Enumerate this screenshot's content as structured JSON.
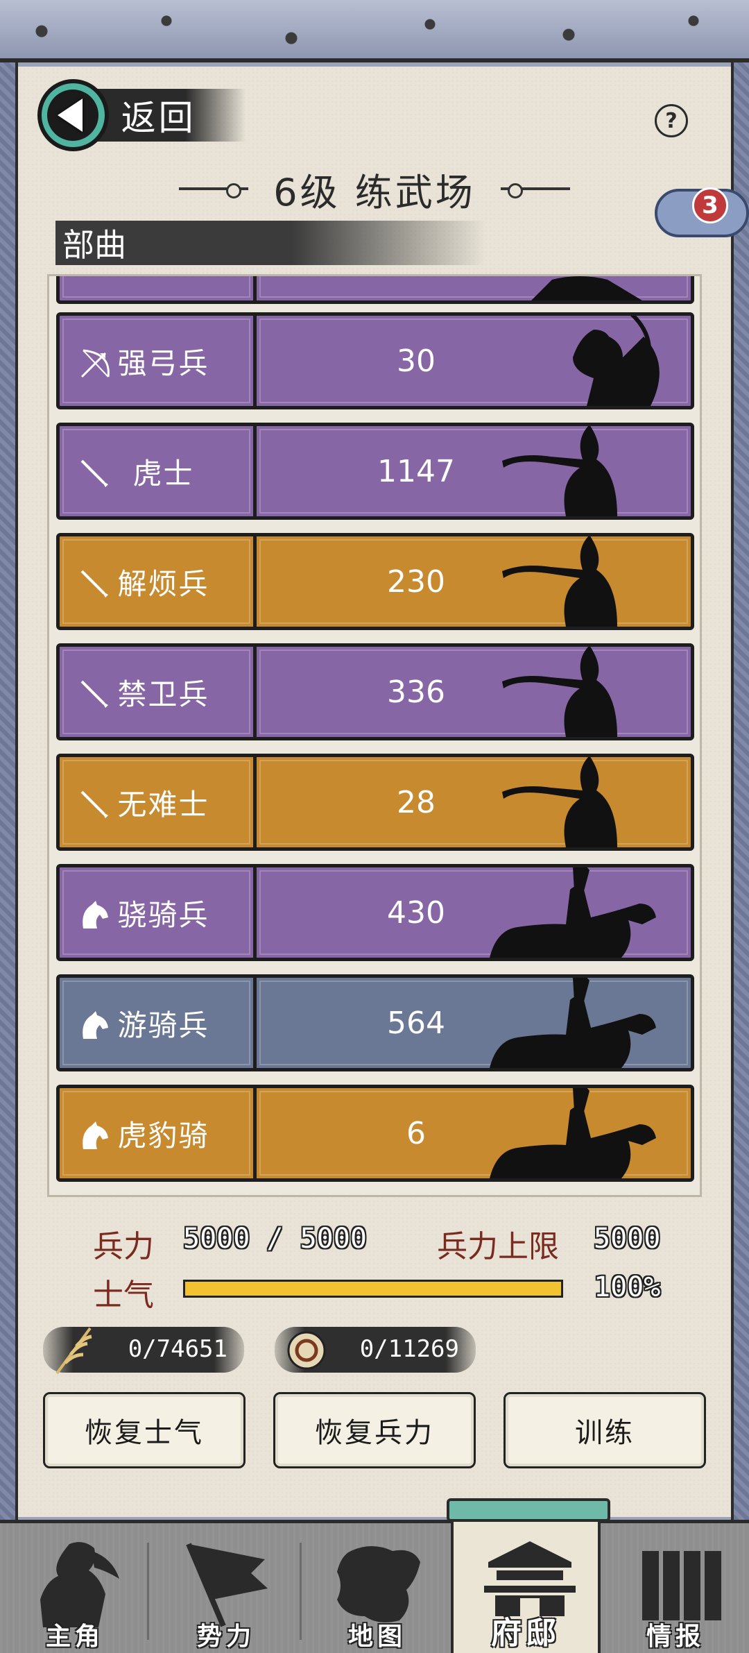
{
  "header": {
    "back_label": "返回",
    "help_symbol": "?",
    "title": "6级 练武场",
    "badge_count": "3",
    "section_title": "部曲"
  },
  "units": [
    {
      "name": "强弓兵",
      "count": "30",
      "color": "#8766a6",
      "icon": "bow-icon",
      "figure": "archer-silhouette"
    },
    {
      "name": "虎士",
      "count": "1147",
      "color": "#8766a6",
      "icon": "sword-icon",
      "figure": "swordsman-silhouette"
    },
    {
      "name": "解烦兵",
      "count": "230",
      "color": "#c88a2e",
      "icon": "sword-icon",
      "figure": "swordsman-silhouette"
    },
    {
      "name": "禁卫兵",
      "count": "336",
      "color": "#8766a6",
      "icon": "sword-icon",
      "figure": "swordsman-silhouette"
    },
    {
      "name": "无难士",
      "count": "28",
      "color": "#c88a2e",
      "icon": "sword-icon",
      "figure": "swordsman-silhouette"
    },
    {
      "name": "骁骑兵",
      "count": "430",
      "color": "#8766a6",
      "icon": "horse-icon",
      "figure": "cavalry-silhouette"
    },
    {
      "name": "游骑兵",
      "count": "564",
      "color": "#6b7895",
      "icon": "horse-icon",
      "figure": "cavalry-silhouette"
    },
    {
      "name": "虎豹骑",
      "count": "6",
      "color": "#c88a2e",
      "icon": "horse-icon",
      "figure": "cavalry-silhouette"
    }
  ],
  "stats": {
    "troops_label": "兵力",
    "troops_value": "5000 / 5000",
    "cap_label": "兵力上限",
    "cap_value": "5000",
    "morale_label": "士气",
    "morale_value": "100%",
    "morale_fraction": 1.0
  },
  "resources": {
    "grain": "0/74651",
    "coin": "0/11269"
  },
  "buttons": {
    "restore_morale": "恢复士气",
    "restore_troops": "恢复兵力",
    "train": "训练"
  },
  "nav": [
    {
      "label": "主角",
      "icon": "hero-icon",
      "active": false
    },
    {
      "label": "势力",
      "icon": "flag-icon",
      "active": false
    },
    {
      "label": "地图",
      "icon": "map-icon",
      "active": false
    },
    {
      "label": "府邸",
      "icon": "mansion-icon",
      "active": true
    },
    {
      "label": "情报",
      "icon": "scroll-icon",
      "active": false
    }
  ],
  "colors": {
    "purple": "#8766a6",
    "orange": "#c88a2e",
    "blue": "#6b7895",
    "morale_bar": "#f2c230",
    "accent_teal": "#4fb4a0"
  }
}
